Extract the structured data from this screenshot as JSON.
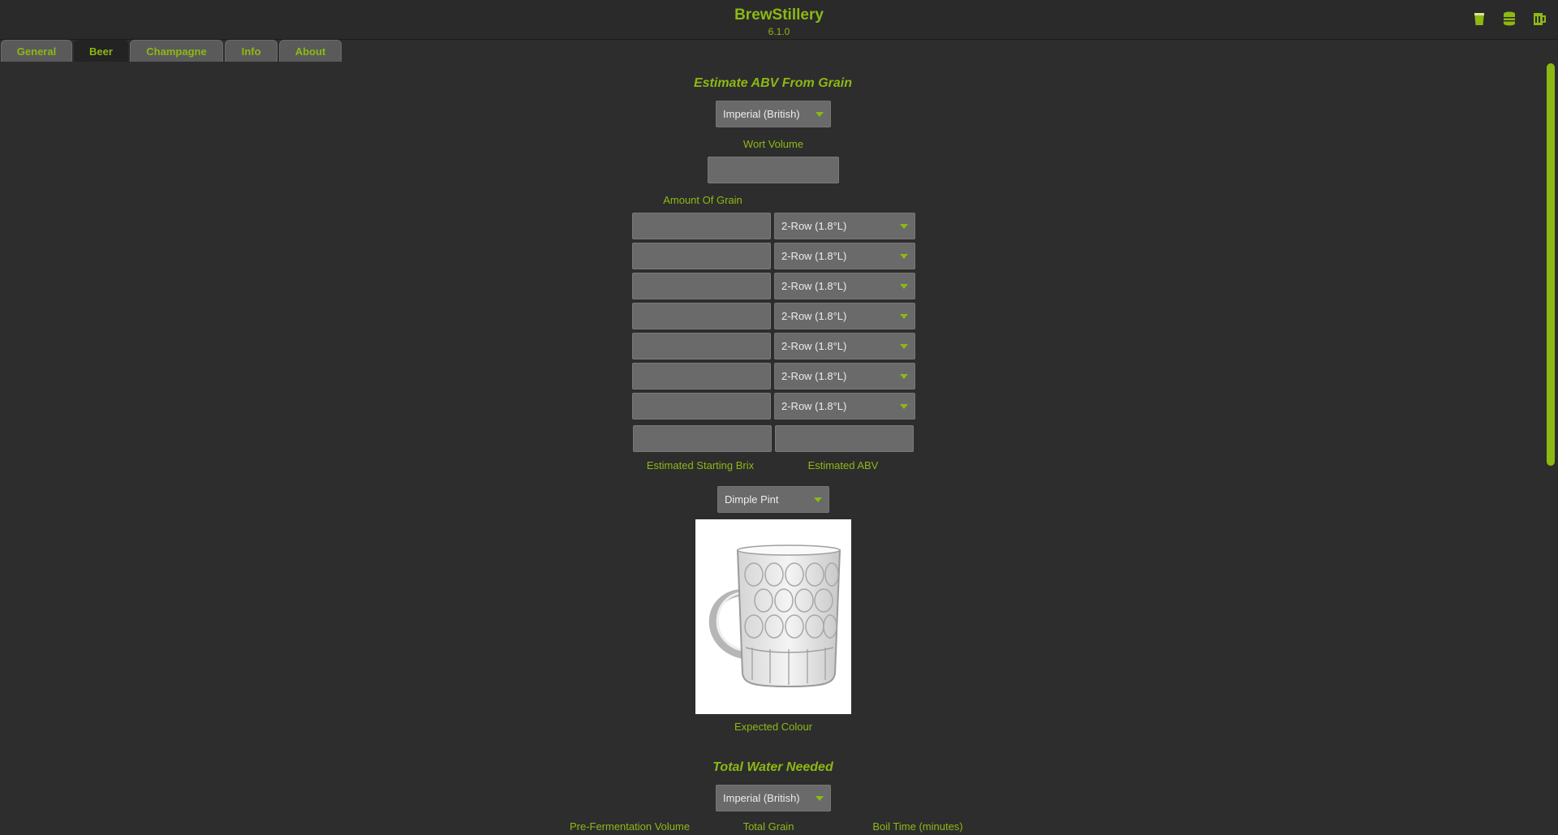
{
  "app": {
    "title": "BrewStillery",
    "version": "6.1.0"
  },
  "toolbar_icons": [
    "beer-glass-icon",
    "keg-icon",
    "beer-mug-icon"
  ],
  "tabs": [
    {
      "label": "General"
    },
    {
      "label": "Beer"
    },
    {
      "label": "Champagne"
    },
    {
      "label": "Info"
    },
    {
      "label": "About"
    }
  ],
  "active_tab": "Beer",
  "abv_section": {
    "title": "Estimate ABV From Grain",
    "unit_select": "Imperial (British)",
    "wort_volume_label": "Wort Volume",
    "wort_volume_value": "",
    "amount_of_grain_label": "Amount Of Grain",
    "grain_rows": [
      {
        "amount": "",
        "grain": "2-Row (1.8°L)"
      },
      {
        "amount": "",
        "grain": "2-Row (1.8°L)"
      },
      {
        "amount": "",
        "grain": "2-Row (1.8°L)"
      },
      {
        "amount": "",
        "grain": "2-Row (1.8°L)"
      },
      {
        "amount": "",
        "grain": "2-Row (1.8°L)"
      },
      {
        "amount": "",
        "grain": "2-Row (1.8°L)"
      },
      {
        "amount": "",
        "grain": "2-Row (1.8°L)"
      }
    ],
    "starting_brix_label": "Estimated Starting Brix",
    "starting_brix_value": "",
    "abv_label": "Estimated ABV",
    "abv_value": "",
    "glass_select": "Dimple Pint",
    "expected_colour_label": "Expected Colour"
  },
  "water_section": {
    "title": "Total Water Needed",
    "unit_select": "Imperial (British)",
    "pre_fermentation_label": "Pre-Fermentation Volume",
    "total_grain_label": "Total Grain",
    "boil_time_label": "Boil Time (minutes)"
  },
  "colors": {
    "accent": "#8db814",
    "background": "#2d2d2d",
    "field": "#6a6a6a"
  }
}
